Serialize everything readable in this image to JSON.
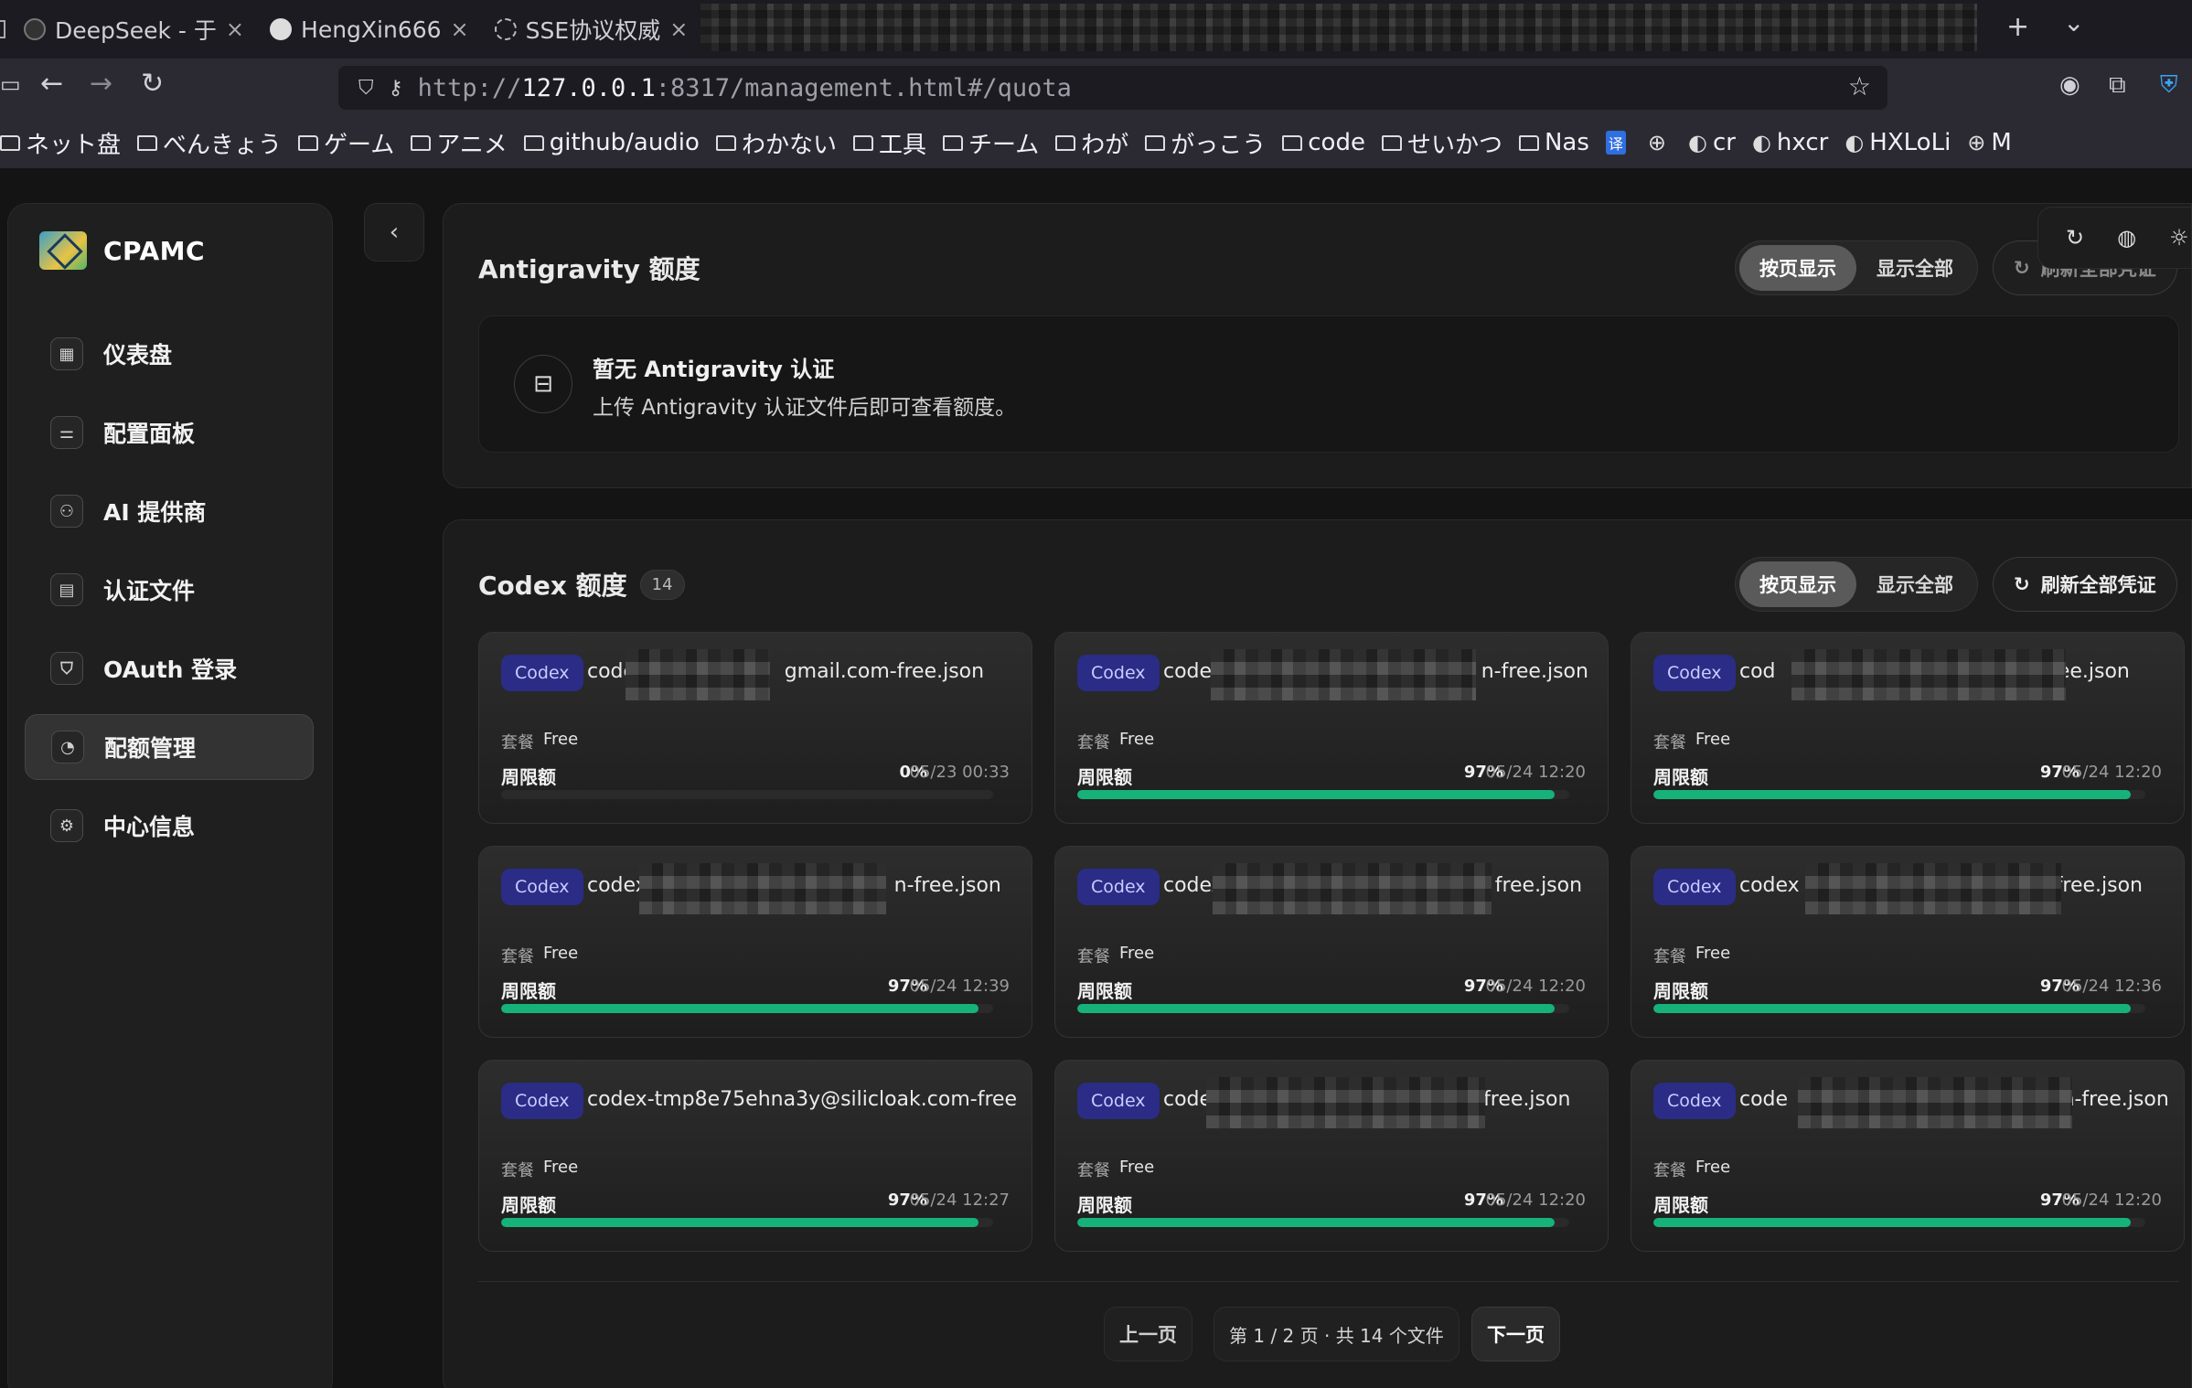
{
  "browser": {
    "tabs": [
      {
        "title": "DeepSeek - 于",
        "icon": "deepseek-icon"
      },
      {
        "title": "HengXin666",
        "icon": "github-icon"
      },
      {
        "title": "SSE协议权威",
        "icon": "openai-icon"
      }
    ],
    "new_tab": "+",
    "tab_list": "⌄",
    "url_host": "127.0.0.1",
    "url_prefix": "http://",
    "url_suffix": ":8317/management.html#/quota",
    "bookmarks": [
      {
        "label": "ネット盘",
        "type": "folder"
      },
      {
        "label": "べんきょう",
        "type": "folder"
      },
      {
        "label": "ゲーム",
        "type": "folder"
      },
      {
        "label": "アニメ",
        "type": "folder"
      },
      {
        "label": "github/audio",
        "type": "folder"
      },
      {
        "label": "わかない",
        "type": "folder"
      },
      {
        "label": "工具",
        "type": "folder"
      },
      {
        "label": "チーム",
        "type": "folder"
      },
      {
        "label": "わが",
        "type": "folder"
      },
      {
        "label": "がっこう",
        "type": "folder"
      },
      {
        "label": "code",
        "type": "folder"
      },
      {
        "label": "せいかつ",
        "type": "folder"
      },
      {
        "label": "Nas",
        "type": "folder"
      },
      {
        "label": "",
        "type": "translate"
      },
      {
        "label": "",
        "type": "globe"
      },
      {
        "label": "cr",
        "type": "site"
      },
      {
        "label": "hxcr",
        "type": "site"
      },
      {
        "label": "HXLoLi",
        "type": "site"
      },
      {
        "label": "M",
        "type": "globe"
      }
    ]
  },
  "sidebar": {
    "app_name": "CPAMC",
    "items": [
      {
        "label": "仪表盘",
        "icon": "dashboard-icon",
        "glyph": "▦",
        "active": false
      },
      {
        "label": "配置面板",
        "icon": "sliders-icon",
        "glyph": "⚌",
        "active": false
      },
      {
        "label": "AI 提供商",
        "icon": "network-icon",
        "glyph": "⚇",
        "active": false
      },
      {
        "label": "认证文件",
        "icon": "file-icon",
        "glyph": "▤",
        "active": false
      },
      {
        "label": "OAuth 登录",
        "icon": "shield-icon",
        "glyph": "⛉",
        "active": false
      },
      {
        "label": "配额管理",
        "icon": "clock-icon",
        "glyph": "◔",
        "active": true
      },
      {
        "label": "中心信息",
        "icon": "chip-icon",
        "glyph": "⚙",
        "active": false
      }
    ]
  },
  "antigravity": {
    "title": "Antigravity 额度",
    "seg_paged": "按页显示",
    "seg_all": "显示全部",
    "refresh": "刷新全部凭证",
    "empty_title": "暂无 Antigravity 认证",
    "empty_desc": "上传 Antigravity 认证文件后即可查看额度。"
  },
  "codex": {
    "title": "Codex 额度",
    "count": "14",
    "seg_paged": "按页显示",
    "seg_all": "显示全部",
    "refresh": "刷新全部凭证",
    "plan_label": "套餐",
    "limit_label": "周限额",
    "cards": [
      {
        "badge": "Codex",
        "name_start": "codex",
        "name_end": "gmail.com-free.json",
        "plan": "Free",
        "percent": "0%",
        "reset": "05/23 00:33",
        "fill": 0
      },
      {
        "badge": "Codex",
        "name_start": "codex",
        "name_end": "n-free.json",
        "plan": "Free",
        "percent": "97%",
        "reset": "05/24 12:20",
        "fill": 0.97
      },
      {
        "badge": "Codex",
        "name_start": "cod",
        "name_end": "free.json",
        "plan": "Free",
        "percent": "97%",
        "reset": "05/24 12:20",
        "fill": 0.97
      },
      {
        "badge": "Codex",
        "name_start": "codex-",
        "name_end": "n-free.json",
        "plan": "Free",
        "percent": "97%",
        "reset": "05/24 12:39",
        "fill": 0.97
      },
      {
        "badge": "Codex",
        "name_start": "codex",
        "name_end": "free.json",
        "plan": "Free",
        "percent": "97%",
        "reset": "05/24 12:20",
        "fill": 0.97
      },
      {
        "badge": "Codex",
        "name_start": "codex",
        "name_end": "-free.json",
        "plan": "Free",
        "percent": "97%",
        "reset": "05/24 12:36",
        "fill": 0.97
      },
      {
        "badge": "Codex",
        "name_start": "codex-tmp8e75ehna3y@silicloak.com-free.json",
        "name_end": "",
        "plan": "Free",
        "percent": "97%",
        "reset": "05/24 12:27",
        "fill": 0.97
      },
      {
        "badge": "Codex",
        "name_start": "code",
        "name_end": "free.json",
        "plan": "Free",
        "percent": "97%",
        "reset": "05/24 12:20",
        "fill": 0.97
      },
      {
        "badge": "Codex",
        "name_start": "code",
        "name_end": "m-free.json",
        "plan": "Free",
        "percent": "97%",
        "reset": "05/24 12:20",
        "fill": 0.97
      }
    ],
    "pager": {
      "prev": "上一页",
      "info": "第 1 / 2 页 · 共 14 个文件",
      "next": "下一页"
    }
  },
  "colors": {
    "accent_green": "#17b27a",
    "badge_bg": "#2a2c86"
  }
}
